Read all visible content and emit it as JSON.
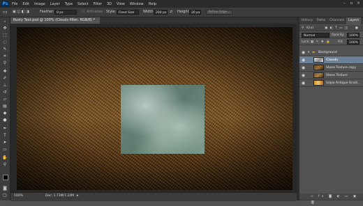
{
  "app": {
    "logo": "Ps"
  },
  "menu": [
    "File",
    "Edit",
    "Image",
    "Layer",
    "Type",
    "Select",
    "Filter",
    "3D",
    "View",
    "Window",
    "Help"
  ],
  "options": {
    "feather_label": "Feather:",
    "feather_value": "0 px",
    "antialias_label": "Anti-alias",
    "style_label": "Style:",
    "style_value": "Fixed Size",
    "width_label": "Width:",
    "width_value": "200 px",
    "height_label": "Height:",
    "height_value": "20 px",
    "refine_label": "Refine Edge..."
  },
  "document": {
    "tab_title": "Rusty Text.psd @ 100% (Clouds filter, RGB/8) *"
  },
  "status": {
    "zoom": "100%",
    "doc_info": "Doc: 1.73M/7.24M"
  },
  "panel": {
    "tabs": [
      "History",
      "Paths",
      "Channels",
      "Layers"
    ],
    "active_tab": "Layers",
    "filter_label": "Kind",
    "blend_mode": "Normal",
    "opacity_label": "Opacity:",
    "opacity_value": "100%",
    "lock_label": "Lock:",
    "fill_label": "Fill:",
    "fill_value": "100%",
    "group_name": "Background",
    "layers": [
      "Clouds",
      "Stone Texture copy",
      "Stone Texture",
      "Sepia Antique Gradi..."
    ],
    "selected_layer": "Clouds"
  },
  "colors": {
    "selection_highlight": "#6b7f96",
    "app_bg": "#535353",
    "menubar": "#2b2b2b",
    "foreground": "#000000",
    "background": "#ffffff"
  }
}
